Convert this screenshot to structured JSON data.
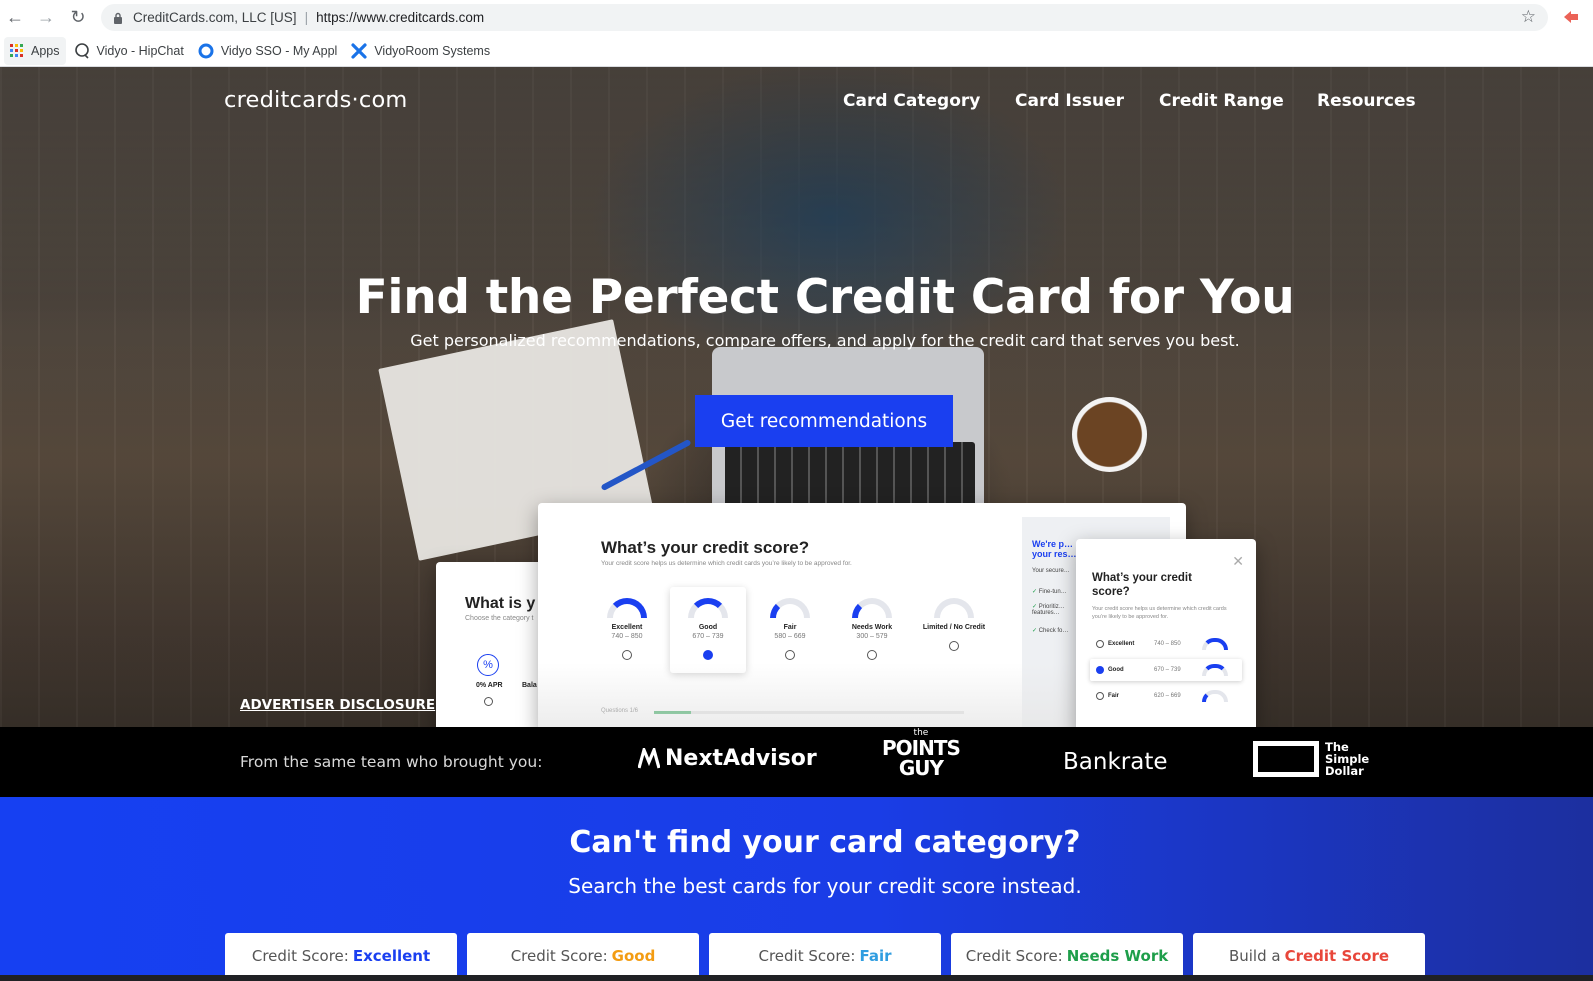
{
  "browser": {
    "site_identity": "CreditCards.com, LLC [US]",
    "url": "https://www.creditcards.com",
    "bookmarks": [
      "Apps",
      "Vidyo - HipChat",
      "Vidyo SSO - My Appl",
      "VidyoRoom Systems"
    ]
  },
  "header": {
    "logo": "creditcards·com",
    "nav": [
      "Card Category",
      "Card Issuer",
      "Credit Range",
      "Resources"
    ]
  },
  "hero": {
    "title": "Find the Perfect Credit Card for You",
    "subtitle": "Get personalized recommendations, compare offers, and apply for the credit card that serves you best.",
    "cta": "Get recommendations",
    "disclosure": "ADVERTISER DISCLOSURE"
  },
  "mock_main": {
    "title": "What’s your credit score?",
    "subtitle": "Your credit score helps us determine which credit cards you’re likely to be approved for.",
    "options": [
      {
        "label": "Excellent",
        "range": "740 – 850"
      },
      {
        "label": "Good",
        "range": "670 – 739"
      },
      {
        "label": "Fair",
        "range": "580 – 669"
      },
      {
        "label": "Needs Work",
        "range": "300 – 579"
      },
      {
        "label": "Limited / No Credit",
        "range": ""
      }
    ],
    "selected": "Good",
    "progress_label": "Questions 1/6",
    "side_heading": "We're p… your res…",
    "side_text": "Your secure…",
    "side_items": [
      "Fine-tun…",
      "Prioritiz… features…",
      "Check fo…"
    ]
  },
  "mock_left": {
    "title": "What is y",
    "subtitle": "Choose the category t",
    "apr": "0% APR",
    "bal": "Bala"
  },
  "mock_right": {
    "title": "What’s your credit score?",
    "subtitle": "Your credit score helps us determine which credit cards you’re likely to be approved for.",
    "rows": [
      {
        "label": "Excellent",
        "range": "740 – 850"
      },
      {
        "label": "Good",
        "range": "670 – 739"
      },
      {
        "label": "Fair",
        "range": "620 – 669"
      }
    ]
  },
  "brands": {
    "lead": "From the same team who brought you:",
    "nextadvisor": "NextAdvisor",
    "points_top": "the",
    "points_mid": "POINTS",
    "points_bot": "GUY",
    "bankrate": "Bankrate",
    "simple_dollar": [
      "The",
      "Simple",
      "Dollar"
    ]
  },
  "category": {
    "title": "Can't find your card category?",
    "subtitle": "Search the best cards for your credit score instead.",
    "buttons": [
      {
        "prefix": "Credit Score:",
        "value": "Excellent",
        "color": "#1a3ff0"
      },
      {
        "prefix": "Credit Score:",
        "value": "Good",
        "color": "#f39c12"
      },
      {
        "prefix": "Credit Score:",
        "value": "Fair",
        "color": "#2f9de0"
      },
      {
        "prefix": "Credit Score:",
        "value": "Needs Work",
        "color": "#1e9e4a"
      },
      {
        "prefix": "Build a",
        "value": "Credit Score",
        "color": "#e8463a"
      }
    ]
  }
}
